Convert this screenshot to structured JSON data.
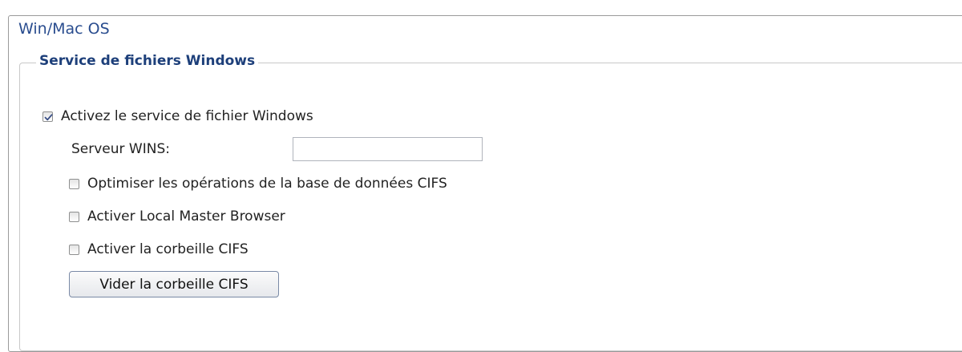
{
  "panel": {
    "title": "Win/Mac OS"
  },
  "windows_file_service": {
    "legend": "Service de fichiers Windows",
    "enable": {
      "label": "Activez le service de fichier Windows",
      "checked": true
    },
    "wins_server": {
      "label": "Serveur WINS:",
      "value": "",
      "placeholder": ""
    },
    "optimize_cifs_db": {
      "label": "Optimiser les opérations de la base de données CIFS",
      "checked": false
    },
    "local_master_browser": {
      "label": "Activer Local Master Browser",
      "checked": false
    },
    "cifs_recycle_bin": {
      "label": "Activer la corbeille CIFS",
      "checked": false
    },
    "empty_recycle_bin_button": "Vider la corbeille CIFS"
  },
  "colors": {
    "title": "#2a4d8f",
    "legend": "#1d3f7a",
    "panel_border": "#9a9a9a",
    "group_border": "#c8c8c8",
    "check_mark": "#3a4f86"
  }
}
